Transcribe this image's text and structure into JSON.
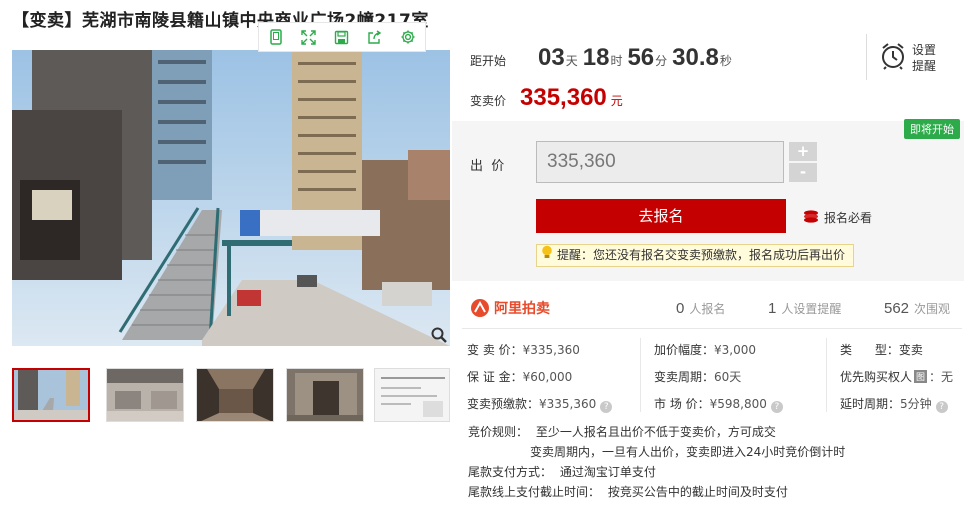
{
  "title": "【变卖】芜湖市南陵县籍山镇中央商业广场2幢217室",
  "toolbar": {
    "icons": [
      "phone-icon",
      "expand-icon",
      "save-icon",
      "share-icon",
      "settings-icon"
    ]
  },
  "countdown": {
    "label": "距开始",
    "days": "03",
    "days_unit": "天",
    "hours": "18",
    "hours_unit": "时",
    "minutes": "56",
    "minutes_unit": "分",
    "seconds": "30.8",
    "seconds_unit": "秒"
  },
  "reminder": {
    "line1": "设置",
    "line2": "提醒"
  },
  "sale_price": {
    "label": "变卖价",
    "value": "335,360",
    "unit": "元"
  },
  "bid": {
    "tag": "即将开始",
    "label": "出  价",
    "input_value": "335,360",
    "plus": "+",
    "minus": "-",
    "signup_button": "去报名",
    "must_read": "报名必看",
    "tip": "提醒：您还没有报名交变卖预缴款，报名成功后再出价"
  },
  "platform": {
    "name": "阿里拍卖",
    "signups_num": "0",
    "signups_label": "人报名",
    "reminders_num": "1",
    "reminders_label": "人设置提醒",
    "views_num": "562",
    "views_label": "次围观"
  },
  "details": {
    "col1": [
      {
        "key": "变 卖 价：",
        "value": "¥335,360"
      },
      {
        "key": "保 证 金：",
        "value": "¥60,000"
      },
      {
        "key": "变卖预缴款：",
        "value": "¥335,360"
      }
    ],
    "col2": [
      {
        "key": "加价幅度：",
        "value": "¥3,000"
      },
      {
        "key": "变卖周期：",
        "value": "60天"
      },
      {
        "key": "市 场 价：",
        "value": "¥598,800"
      }
    ],
    "col3": [
      {
        "key": "类      型：",
        "value": "变卖"
      },
      {
        "key": "优先购买权人",
        "badge": "图",
        "value": "：无"
      },
      {
        "key": "延时周期：",
        "value": "5分钟"
      }
    ]
  },
  "rules": {
    "bid_rule_label": "竞价规则：",
    "bid_rule_1": "至少一人报名且出价不低于变卖价，方可成交",
    "bid_rule_2": "变卖周期内，一旦有人出价，变卖即进入24小时竞价倒计时",
    "payment_label": "尾款支付方式：",
    "payment_value": "通过淘宝订单支付",
    "deadline_label": "尾款线上支付截止时间：",
    "deadline_value": "按竞买公告中的截止时间及时支付"
  },
  "colors": {
    "accent": "#c40000",
    "green_tag": "#2dab4a",
    "brand": "#e84b2c"
  }
}
